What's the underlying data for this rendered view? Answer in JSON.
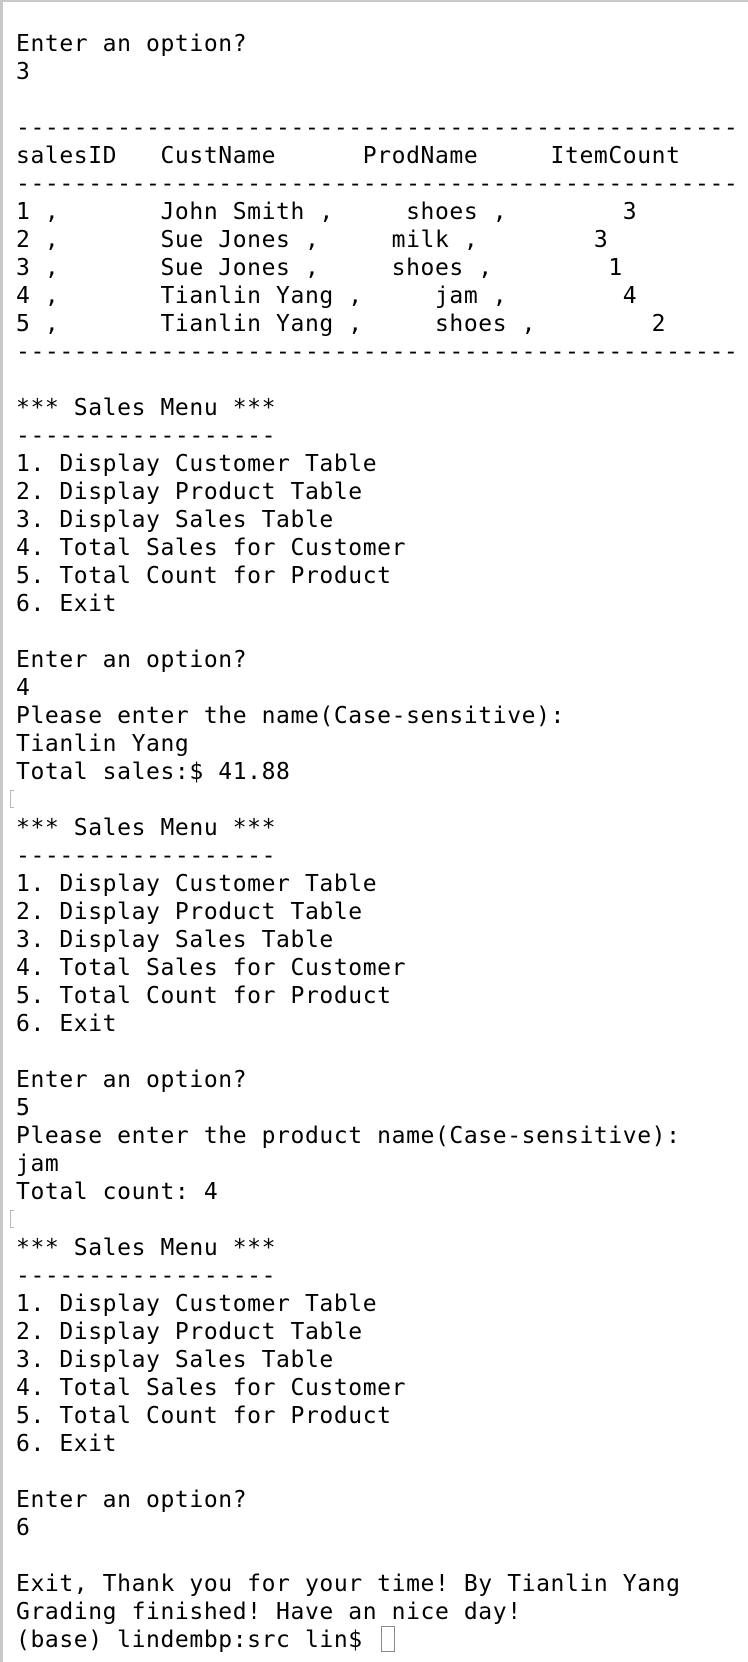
{
  "lines": [
    "",
    "Enter an option?",
    "3",
    "",
    "--------------------------------------------------",
    "salesID   CustName      ProdName     ItemCount",
    "--------------------------------------------------",
    "1 ,       John Smith ,     shoes ,        3",
    "2 ,       Sue Jones ,     milk ,        3",
    "3 ,       Sue Jones ,     shoes ,        1",
    "4 ,       Tianlin Yang ,     jam ,        4",
    "5 ,       Tianlin Yang ,     shoes ,        2",
    "--------------------------------------------------",
    "",
    "*** Sales Menu ***",
    "------------------",
    "1. Display Customer Table",
    "2. Display Product Table",
    "3. Display Sales Table",
    "4. Total Sales for Customer",
    "5. Total Count for Product",
    "6. Exit",
    "",
    "Enter an option?",
    "4",
    "Please enter the name(Case-sensitive):",
    "Tianlin Yang",
    "Total sales:$ 41.88",
    "",
    "*** Sales Menu ***",
    "------------------",
    "1. Display Customer Table",
    "2. Display Product Table",
    "3. Display Sales Table",
    "4. Total Sales for Customer",
    "5. Total Count for Product",
    "6. Exit",
    "",
    "Enter an option?",
    "5",
    "Please enter the product name(Case-sensitive):",
    "jam",
    "Total count: 4",
    "",
    "*** Sales Menu ***",
    "------------------",
    "1. Display Customer Table",
    "2. Display Product Table",
    "3. Display Sales Table",
    "4. Total Sales for Customer",
    "5. Total Count for Product",
    "6. Exit",
    "",
    "Enter an option?",
    "6",
    "",
    "Exit, Thank you for your time! By Tianlin Yang",
    "Grading finished! Have an nice day!",
    "(base) lindembp:src lin$ "
  ]
}
